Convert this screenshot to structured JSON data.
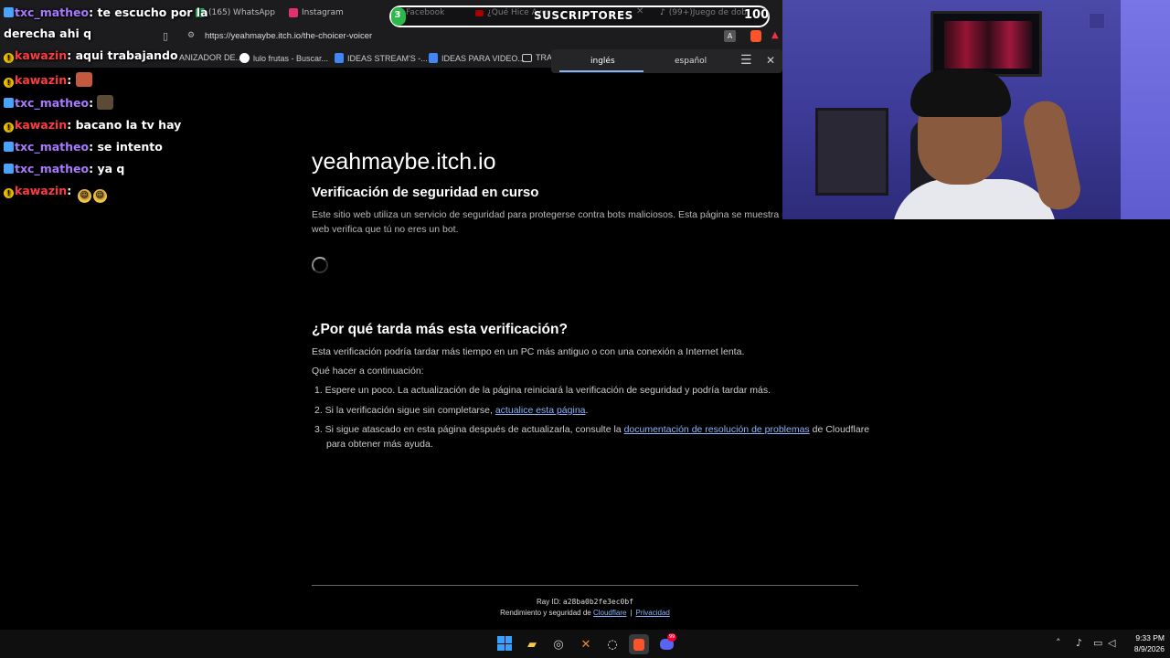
{
  "browser": {
    "tabs": [
      {
        "label": "(165) WhatsApp",
        "color": "#25d366"
      },
      {
        "label": "Instagram",
        "color": "#e1306c"
      },
      {
        "label": "Facebook",
        "color": "#1877f2"
      },
      {
        "label": "¿Qué Hice Ayer",
        "color": "#ff0000"
      },
      {
        "label": "(99+)Juego de dob",
        "color": "#555555"
      }
    ],
    "url": "https://yeahmaybe.itch.io/the-choicer-voicer",
    "bookmarks": [
      {
        "label": "ANIZADOR DE..."
      },
      {
        "label": "lulo frutas - Buscar..."
      },
      {
        "label": "IDEAS STREAM'S -..."
      },
      {
        "label": "IDEAS PARA VIDEO..."
      },
      {
        "label": "TRA"
      }
    ],
    "translate": {
      "source": "inglés",
      "target": "español"
    }
  },
  "subscribers": {
    "current": "3",
    "label": "SUSCRIPTORES",
    "goal": "100",
    "progress": 0.03,
    "color": "#2db84d"
  },
  "chat": [
    {
      "badge": "blue",
      "user": "txc_matheo",
      "sep": ": ",
      "text": "te escucho por la"
    },
    {
      "badge": "none",
      "user": "",
      "sep": "",
      "text": "derecha ahi q"
    },
    {
      "badge": "gold",
      "user": "kawazin",
      "sep": ": ",
      "text": "aqui trabajando"
    },
    {
      "badge": "gold",
      "user": "kawazin",
      "sep": ": ",
      "text": "",
      "emote": "face-emote"
    },
    {
      "badge": "blue",
      "user": "txc_matheo",
      "sep": ": ",
      "text": "",
      "emote": "dog-emote"
    },
    {
      "badge": "gold",
      "user": "kawazin",
      "sep": ": ",
      "text": "bacano la tv hay"
    },
    {
      "badge": "blue",
      "user": "txc_matheo",
      "sep": ": ",
      "text": "se intento"
    },
    {
      "badge": "blue",
      "user": "txc_matheo",
      "sep": ": ",
      "text": "ya q"
    },
    {
      "badge": "gold",
      "user": "kawazin",
      "sep": ": ",
      "text": "",
      "emoji_count": 2
    }
  ],
  "page": {
    "site": "yeahmaybe.itch.io",
    "heading": "Verificación de seguridad en curso",
    "description_l1": "Este sitio web utiliza un servicio de seguridad para protegerse contra bots maliciosos. Esta página se muestra",
    "description_l2": "web verifica que tú no eres un bot.",
    "why_heading": "¿Por qué tarda más esta verificación?",
    "why_text": "Esta verificación podría tardar más tiempo en un PC más antiguo o con una conexión a Internet lenta.",
    "next_label": "Qué hacer a continuación:",
    "step1": "1.  Espere un poco. La actualización de la página reiniciará la verificación de seguridad y podría tardar más.",
    "step2_pre": "2.  Si la verificación sigue sin completarse, ",
    "step2_link": "actualice esta página",
    "step2_post": ".",
    "step3_pre": "3.  Si sigue atascado en esta página después de actualizarla, consulte la ",
    "step3_link": "documentación de resolución de problemas",
    "step3_post": " de Cloudflare",
    "step3_l2": "para obtener más ayuda.",
    "ray_label": "Ray ID: ",
    "ray_id": "a28ba0b2fe3ec0bf",
    "perf_pre": "Rendimiento y seguridad de ",
    "perf_link": "Cloudflare",
    "privacy": "Privacidad"
  },
  "taskbar": {
    "time": "9:33 PM",
    "date": "8/9/2026",
    "discord_badge": "99"
  }
}
